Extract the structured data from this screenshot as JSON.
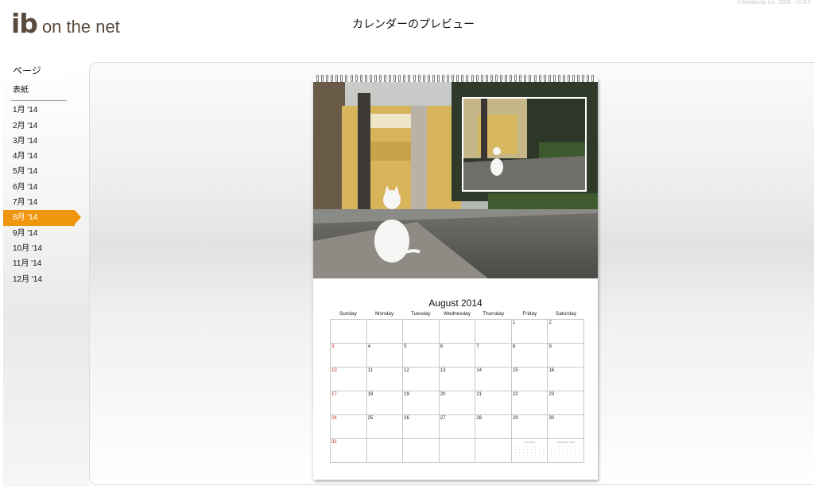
{
  "header": {
    "logo_ib": "ib",
    "logo_rest": "on the net",
    "title": "カレンダーのプレビュー",
    "copyright": "© Mediaclip Inc. 2008 - v2.8.2"
  },
  "sidebar": {
    "tab_label": "ページ",
    "cover_label": "表紙",
    "items": [
      {
        "label": "1月 '14"
      },
      {
        "label": "2月 '14"
      },
      {
        "label": "3月 '14"
      },
      {
        "label": "4月 '14"
      },
      {
        "label": "5月 '14"
      },
      {
        "label": "6月 '14"
      },
      {
        "label": "7月 '14"
      },
      {
        "label": "8月 '14",
        "active": true
      },
      {
        "label": "9月 '14"
      },
      {
        "label": "10月 '14"
      },
      {
        "label": "11月 '14"
      },
      {
        "label": "12月 '14"
      }
    ],
    "active_color": "#f0960e"
  },
  "calendar": {
    "month_title": "August 2014",
    "days_of_week": [
      "Sunday",
      "Monday",
      "Tuesday",
      "Wednesday",
      "Thursday",
      "Friday",
      "Saturday"
    ],
    "weeks": [
      [
        "",
        "",
        "",
        "",
        "",
        "1",
        "2"
      ],
      [
        "3",
        "4",
        "5",
        "6",
        "7",
        "8",
        "9"
      ],
      [
        "10",
        "11",
        "12",
        "13",
        "14",
        "15",
        "16"
      ],
      [
        "17",
        "18",
        "19",
        "20",
        "21",
        "22",
        "23"
      ],
      [
        "24",
        "25",
        "26",
        "27",
        "28",
        "29",
        "30"
      ],
      [
        "31",
        "",
        "",
        "",
        "",
        "",
        ""
      ]
    ],
    "mini_prev": "July 2014",
    "mini_next": "September 2014",
    "sunday_color": "#c02020"
  }
}
